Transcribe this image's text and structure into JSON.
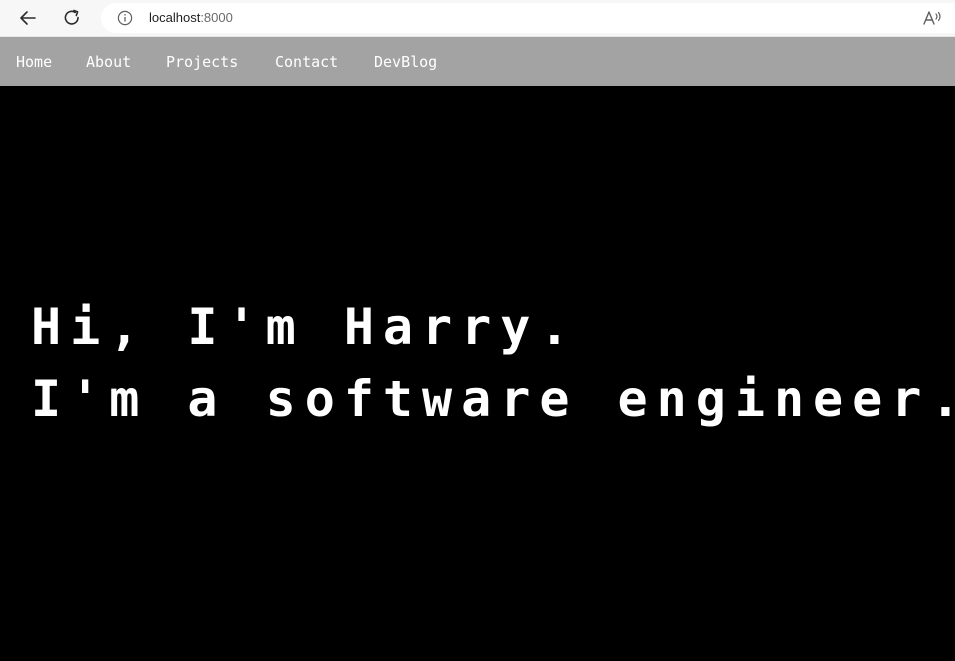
{
  "browser": {
    "url_host": "localhost",
    "url_port": ":8000",
    "icons": {
      "back": "back-arrow-icon",
      "reload": "reload-icon",
      "info": "info-icon",
      "read_aloud": "read-aloud-icon"
    }
  },
  "nav": {
    "items": [
      {
        "label": "Home"
      },
      {
        "label": "About"
      },
      {
        "label": "Projects"
      },
      {
        "label": "Contact"
      },
      {
        "label": "DevBlog"
      }
    ]
  },
  "hero": {
    "line1": "Hi, I'm Harry.",
    "line2": "I'm a software engineer."
  },
  "colors": {
    "page_background": "#000000",
    "nav_background": "#a3a3a3",
    "text": "#ffffff"
  }
}
